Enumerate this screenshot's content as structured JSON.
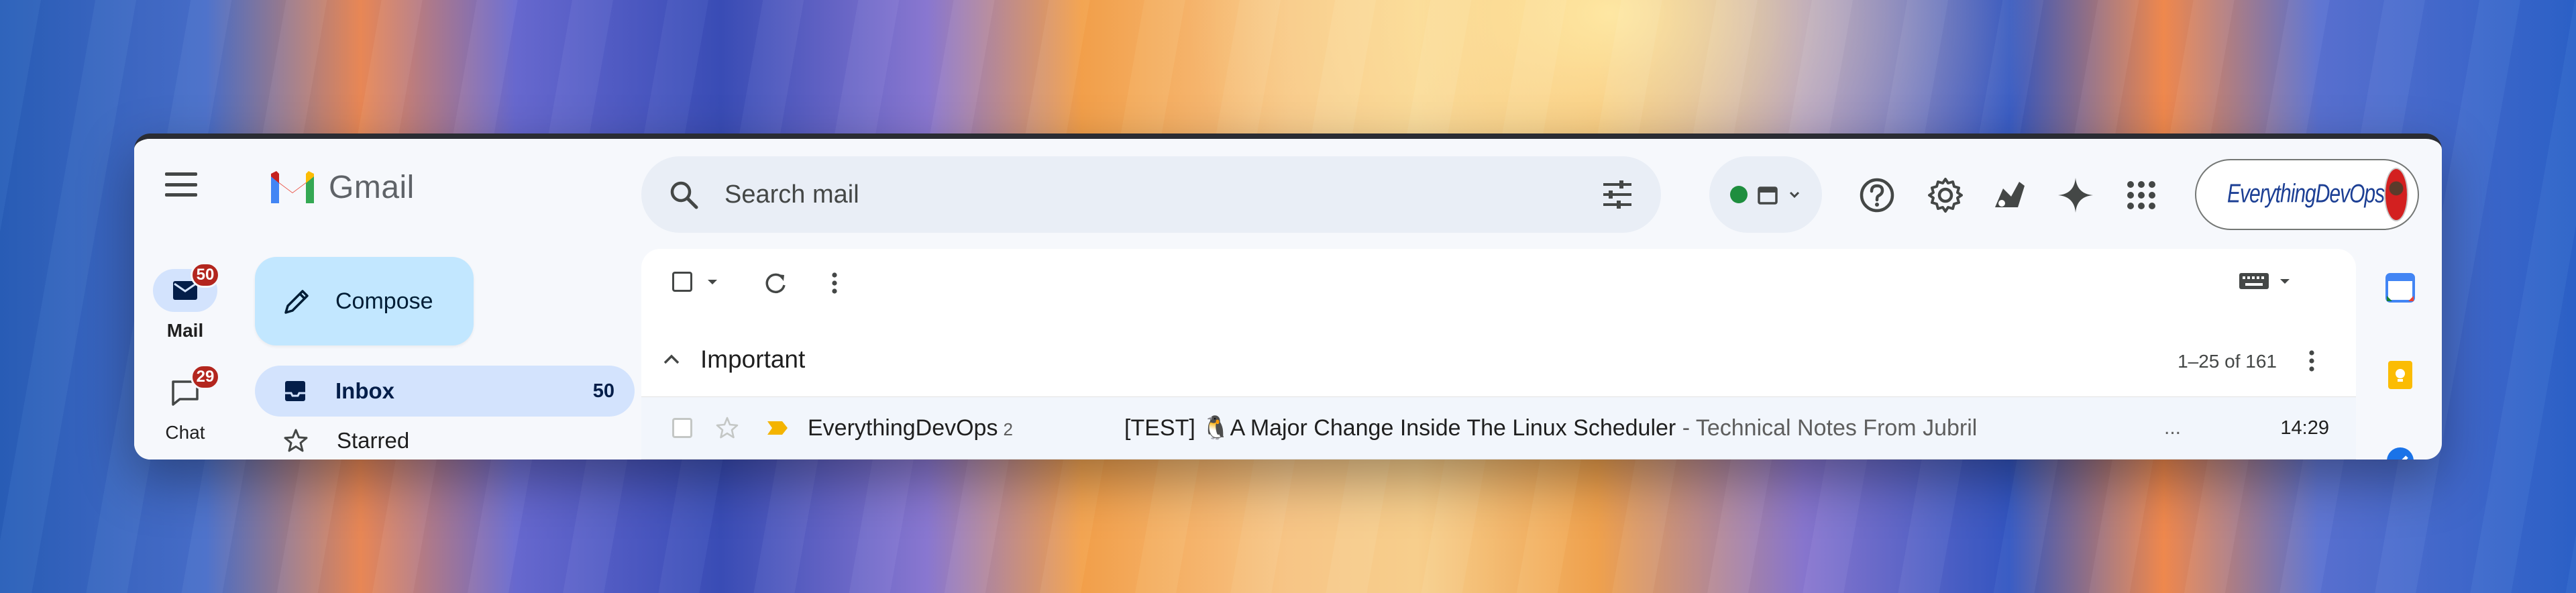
{
  "app": {
    "name": "Gmail"
  },
  "rail": {
    "items": [
      {
        "label": "Mail",
        "badge": "50"
      },
      {
        "label": "Chat",
        "badge": "29"
      }
    ]
  },
  "compose": {
    "label": "Compose"
  },
  "nav": {
    "items": [
      {
        "label": "Inbox",
        "count": "50"
      },
      {
        "label": "Starred"
      }
    ]
  },
  "search": {
    "placeholder": "Search mail"
  },
  "account": {
    "brand": "EverythingDevOps"
  },
  "list": {
    "section": "Important",
    "range": "1–25 of 161",
    "rows": [
      {
        "sender": "EverythingDevOps",
        "thread_count": "2",
        "subject": "[TEST] 🐧A Major Change Inside The Linux Scheduler",
        "snippet": " - Technical Notes From Jubril",
        "ellipsis": "...",
        "time": "14:29"
      }
    ]
  },
  "colors": {
    "accent": "#d3e3fd",
    "compose": "#c2e7ff",
    "badge": "#b3261e",
    "status_dot": "#1e8e3e",
    "important_marker": "#f4b400"
  },
  "icons": [
    "menu-icon",
    "mail-icon",
    "chat-icon",
    "pencil-icon",
    "inbox-icon",
    "star-icon",
    "search-icon",
    "tune-icon",
    "calendar-icon",
    "help-icon",
    "gear-icon",
    "gemini-icon",
    "apps-icon",
    "keyboard-icon"
  ]
}
